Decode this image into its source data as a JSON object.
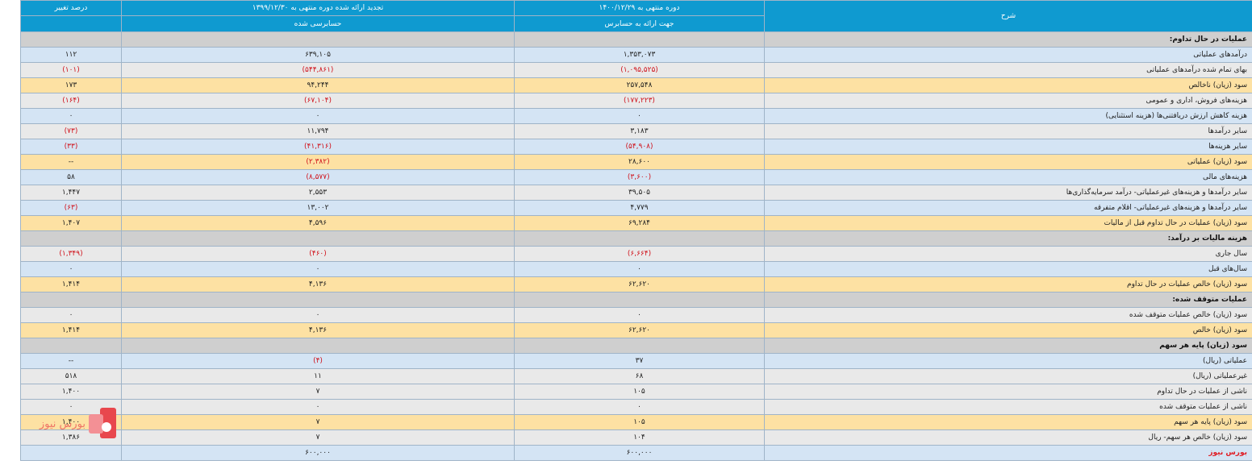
{
  "header": {
    "change_pct": "درصد تغییر",
    "prior_period": "تجدید ارائه شده دوره منتهی به ۱۳۹۹/۱۲/۳۰",
    "current_period": "دوره منتهی به ۱۴۰۰/۱۲/۲۹",
    "description": "شرح",
    "prior_status": "حسابرسی شده",
    "current_status": "جهت ارائه به حسابرس"
  },
  "rows": [
    {
      "type": "sec",
      "desc": "عملیات در حال تداوم:"
    },
    {
      "type": "blue",
      "desc": "درآمدهای عملیاتی",
      "cur": "۱,۳۵۳,۰۷۳",
      "prev": "۶۳۹,۱۰۵",
      "chg": "۱۱۲"
    },
    {
      "type": "grey",
      "desc": "بهای تمام شده درآمدهای عملیاتی",
      "cur": "(۱,۰۹۵,۵۲۵)",
      "prev": "(۵۴۴,۸۶۱)",
      "chg": "(۱۰۱)",
      "cur_neg": true,
      "prev_neg": true,
      "chg_neg": true
    },
    {
      "type": "yellow",
      "desc": "سود (زیان) ناخالص",
      "cur": "۲۵۷,۵۴۸",
      "prev": "۹۴,۲۴۴",
      "chg": "۱۷۳"
    },
    {
      "type": "grey",
      "desc": "هزینه‌های فروش، اداری و عمومی",
      "cur": "(۱۷۷,۲۲۳)",
      "prev": "(۶۷,۱۰۴)",
      "chg": "(۱۶۴)",
      "cur_neg": true,
      "prev_neg": true,
      "chg_neg": true
    },
    {
      "type": "blue",
      "desc": "هزینه کاهش ارزش دریافتنی‌ها (هزینه استثنایی)",
      "cur": "۰",
      "prev": "۰",
      "chg": "۰"
    },
    {
      "type": "grey",
      "desc": "سایر درآمدها",
      "cur": "۳,۱۸۳",
      "prev": "۱۱,۷۹۴",
      "chg": "(۷۳)",
      "chg_neg": true
    },
    {
      "type": "blue",
      "desc": "سایر هزینه‌ها",
      "cur": "(۵۴,۹۰۸)",
      "prev": "(۴۱,۳۱۶)",
      "chg": "(۳۳)",
      "cur_neg": true,
      "prev_neg": true,
      "chg_neg": true
    },
    {
      "type": "yellow",
      "desc": "سود (زیان) عملیاتی",
      "cur": "۲۸,۶۰۰",
      "prev": "(۲,۳۸۲)",
      "chg": "--",
      "prev_neg": true
    },
    {
      "type": "blue",
      "desc": "هزینه‌های مالی",
      "cur": "(۳,۶۰۰)",
      "prev": "(۸,۵۷۷)",
      "chg": "۵۸",
      "cur_neg": true,
      "prev_neg": true
    },
    {
      "type": "grey",
      "desc": "سایر درآمدها و هزینه‌های غیرعملیاتی- درآمد سرمایه‌گذاری‌ها",
      "cur": "۳۹,۵۰۵",
      "prev": "۲,۵۵۳",
      "chg": "۱,۴۴۷"
    },
    {
      "type": "blue",
      "desc": "سایر درآمدها و هزینه‌های غیرعملیاتی- اقلام متفرقه",
      "cur": "۴,۷۷۹",
      "prev": "۱۳,۰۰۲",
      "chg": "(۶۳)",
      "chg_neg": true
    },
    {
      "type": "yellow",
      "desc": "سود (زیان) عملیات در حال تداوم قبل از مالیات",
      "cur": "۶۹,۲۸۴",
      "prev": "۴,۵۹۶",
      "chg": "۱,۴۰۷"
    },
    {
      "type": "sec",
      "desc": "هزینه مالیات بر درآمد:"
    },
    {
      "type": "grey",
      "desc": "سال جاری",
      "cur": "(۶,۶۶۴)",
      "prev": "(۴۶۰)",
      "chg": "(۱,۳۴۹)",
      "cur_neg": true,
      "prev_neg": true,
      "chg_neg": true
    },
    {
      "type": "blue",
      "desc": "سال‌های قبل",
      "cur": "۰",
      "prev": "۰",
      "chg": "۰"
    },
    {
      "type": "yellow",
      "desc": "سود (زیان) خالص عملیات در حال تداوم",
      "cur": "۶۲,۶۲۰",
      "prev": "۴,۱۳۶",
      "chg": "۱,۴۱۴"
    },
    {
      "type": "sec",
      "desc": "عملیات متوقف شده:"
    },
    {
      "type": "grey",
      "desc": "سود (زیان) خالص عملیات متوقف شده",
      "cur": "۰",
      "prev": "۰",
      "chg": "۰"
    },
    {
      "type": "yellow",
      "desc": "سود (زیان) خالص",
      "cur": "۶۲,۶۲۰",
      "prev": "۴,۱۳۶",
      "chg": "۱,۴۱۴"
    },
    {
      "type": "sec",
      "desc": "سود (زیان) پایه هر سهم"
    },
    {
      "type": "blue",
      "desc": "عملیاتی (ریال)",
      "cur": "۳۷",
      "prev": "(۴)",
      "chg": "--",
      "prev_neg": true
    },
    {
      "type": "grey",
      "desc": "غیرعملیاتی (ریال)",
      "cur": "۶۸",
      "prev": "۱۱",
      "chg": "۵۱۸"
    },
    {
      "type": "grey",
      "desc": "ناشی از عملیات در حال تداوم",
      "cur": "۱۰۵",
      "prev": "۷",
      "chg": "۱,۴۰۰"
    },
    {
      "type": "grey",
      "desc": "ناشی از عملیات متوقف شده",
      "cur": "۰",
      "prev": "۰",
      "chg": "۰"
    },
    {
      "type": "yellow",
      "desc": "سود (زیان) پایه هر سهم",
      "cur": "۱۰۵",
      "prev": "۷",
      "chg": "۱,۴۰۰"
    },
    {
      "type": "grey",
      "desc": "سود (زیان) خالص هر سهم- ریال",
      "cur": "۱۰۴",
      "prev": "۷",
      "chg": "۱,۳۸۶"
    }
  ],
  "footer": {
    "brand": "بورس نیوز",
    "cur": "۶۰۰,۰۰۰",
    "prev": "۶۰۰,۰۰۰"
  },
  "logo_text": "بورس نیوز"
}
